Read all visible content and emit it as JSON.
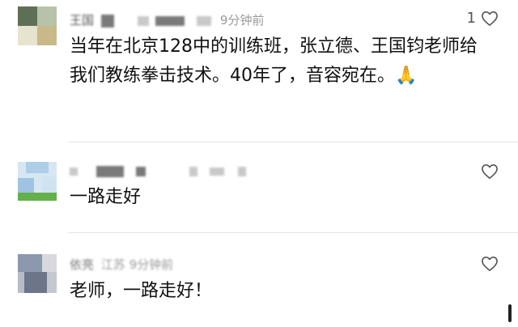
{
  "comments": [
    {
      "username": "王国",
      "time": "9分钟前",
      "like_count": "1",
      "text": "当年在北京128中的训练班，张立德、王国钧老师给我们教练拳击技术。40年了，音容宛在。🙏"
    },
    {
      "username": "",
      "time": "",
      "like_count": "",
      "text": "一路走好"
    },
    {
      "username": "依亮",
      "time": "江苏 9分钟前",
      "like_count": "",
      "text": "老师，一路走好！"
    }
  ],
  "icons": {
    "like": "heart-outline-icon"
  },
  "colors": {
    "meta_text": "#9a9a9a",
    "body_text": "#111111",
    "divider": "#e6e6e6"
  }
}
